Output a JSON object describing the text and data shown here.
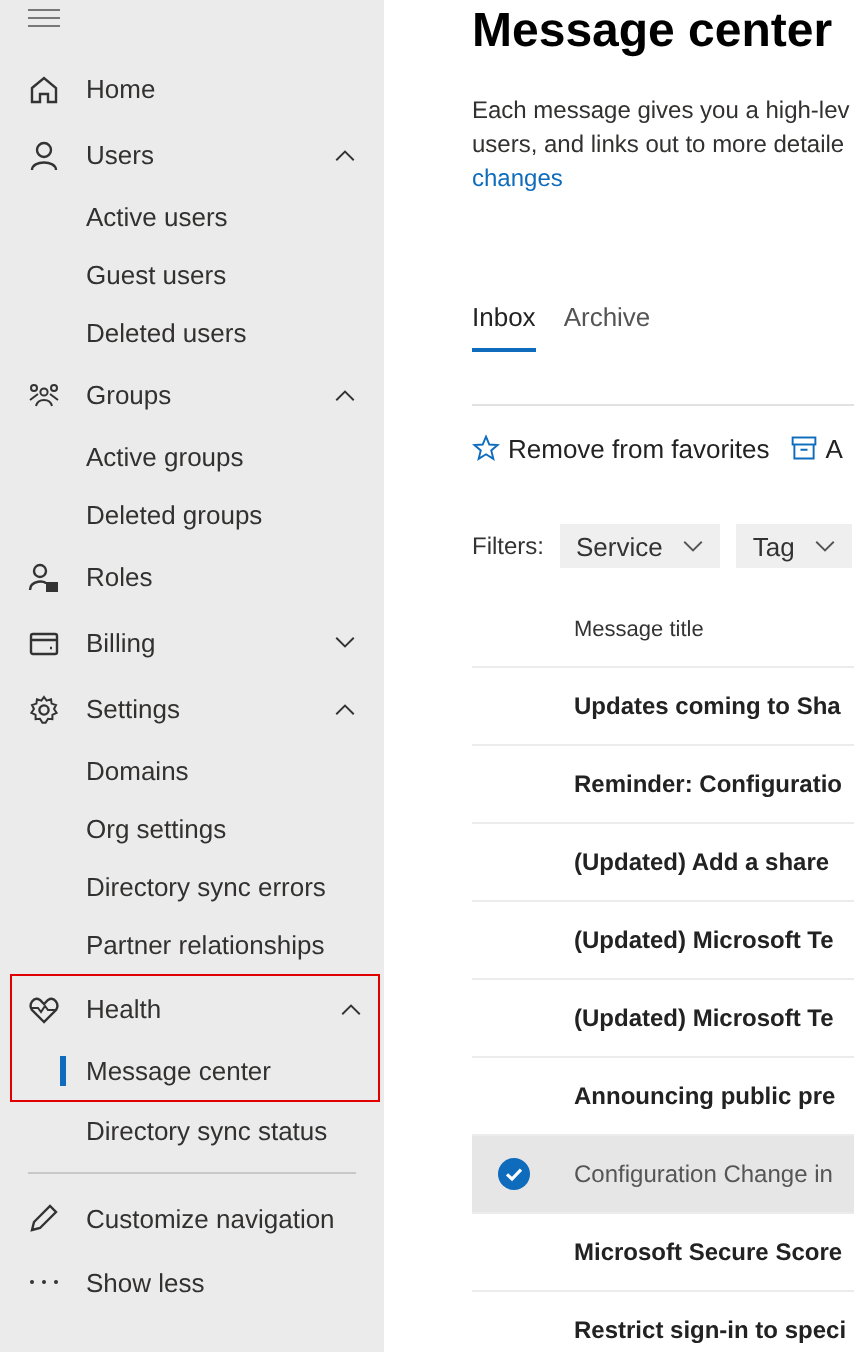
{
  "nav": {
    "items": [
      {
        "label": "Home",
        "highlighted": false
      },
      {
        "label": "Users",
        "expanded": true,
        "highlighted": false,
        "children": [
          {
            "label": "Active users",
            "selected": false
          },
          {
            "label": "Guest users",
            "selected": false
          },
          {
            "label": "Deleted users",
            "selected": false
          }
        ]
      },
      {
        "label": "Groups",
        "expanded": true,
        "highlighted": false,
        "children": [
          {
            "label": "Active groups",
            "selected": false
          },
          {
            "label": "Deleted groups",
            "selected": false
          }
        ]
      },
      {
        "label": "Roles",
        "highlighted": false
      },
      {
        "label": "Billing",
        "expanded": false,
        "highlighted": false
      },
      {
        "label": "Settings",
        "expanded": true,
        "highlighted": false,
        "children": [
          {
            "label": "Domains",
            "selected": false
          },
          {
            "label": "Org settings",
            "selected": false
          },
          {
            "label": "Directory sync errors",
            "selected": false
          },
          {
            "label": "Partner relationships",
            "selected": false
          }
        ]
      },
      {
        "label": "Health",
        "expanded": true,
        "highlighted": true,
        "children": [
          {
            "label": "Message center",
            "selected": true
          }
        ]
      }
    ],
    "after_highlight": [
      {
        "label": "Directory sync status",
        "selected": false
      }
    ],
    "footer": [
      "Customize navigation",
      "Show less"
    ]
  },
  "page": {
    "title": "Message center",
    "description": "Each message gives you a high-lev",
    "description_2": "users, and links out to more detaile",
    "link": "changes"
  },
  "tabs": [
    {
      "label": "Inbox",
      "selected": true
    },
    {
      "label": "Archive",
      "selected": false
    }
  ],
  "commands": [
    "Remove from favorites",
    "A"
  ],
  "filters": {
    "label": "Filters:",
    "dropdowns": [
      "Service",
      "Tag"
    ]
  },
  "table": {
    "columns": [
      "Message title"
    ],
    "rows": [
      {
        "title": "Updates coming to Sha",
        "unread": true,
        "selected": false
      },
      {
        "title": "Reminder: Configuratio",
        "unread": true,
        "selected": false
      },
      {
        "title": "(Updated) Add a share",
        "unread": true,
        "selected": false
      },
      {
        "title": "(Updated) Microsoft Te",
        "unread": true,
        "selected": false
      },
      {
        "title": "(Updated) Microsoft Te",
        "unread": true,
        "selected": false
      },
      {
        "title": "Announcing public pre",
        "unread": true,
        "selected": false
      },
      {
        "title": "Configuration Change in",
        "unread": false,
        "selected": true
      },
      {
        "title": "Microsoft Secure Score",
        "unread": true,
        "selected": false
      },
      {
        "title": "Restrict sign-in to speci",
        "unread": true,
        "selected": false
      }
    ]
  }
}
